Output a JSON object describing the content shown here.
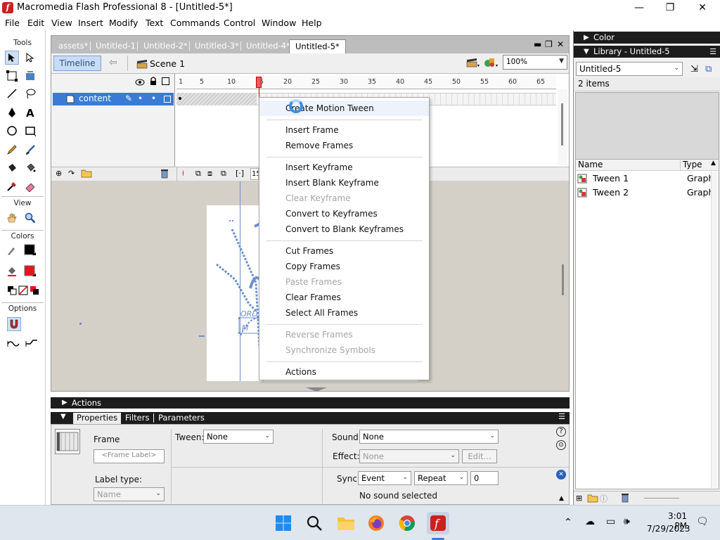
{
  "window": {
    "title": "Macromedia Flash Professional 8 - [Untitled-5*]",
    "minimize": "—",
    "maximize": "❐",
    "close": "✕"
  },
  "menu": [
    "File",
    "Edit",
    "View",
    "Insert",
    "Modify",
    "Text",
    "Commands",
    "Control",
    "Window",
    "Help"
  ],
  "toolbox": {
    "tools_label": "Tools",
    "view_label": "View",
    "colors_label": "Colors",
    "options_label": "Options",
    "stroke_color": "#000000",
    "fill_color": "#e8141b"
  },
  "document": {
    "tabs": [
      "assets*",
      "Untitled-1",
      "Untitled-2*",
      "Untitled-3*",
      "Untitled-4*",
      "Untitled-5*"
    ],
    "active_tab": "Untitled-5*",
    "timeline_button": "Timeline",
    "scene": "Scene 1",
    "zoom": "100%"
  },
  "timeline": {
    "layer_name": "content",
    "ruler": [
      "1",
      "5",
      "10",
      "15",
      "20",
      "25",
      "30",
      "35",
      "40",
      "45",
      "50",
      "55",
      "60",
      "65"
    ],
    "current_frame": "15",
    "frame_field": "15"
  },
  "stage": {
    "text_1": "ORD",
    "text_2": "M"
  },
  "context_menu": [
    {
      "label": "Create Motion Tween",
      "enabled": true,
      "hover": true
    },
    {
      "sep": true
    },
    {
      "label": "Insert Frame",
      "enabled": true
    },
    {
      "label": "Remove Frames",
      "enabled": true
    },
    {
      "sep": true
    },
    {
      "label": "Insert Keyframe",
      "enabled": true
    },
    {
      "label": "Insert Blank Keyframe",
      "enabled": true
    },
    {
      "label": "Clear Keyframe",
      "enabled": false
    },
    {
      "label": "Convert to Keyframes",
      "enabled": true
    },
    {
      "label": "Convert to Blank Keyframes",
      "enabled": true
    },
    {
      "sep": true
    },
    {
      "label": "Cut Frames",
      "enabled": true
    },
    {
      "label": "Copy Frames",
      "enabled": true
    },
    {
      "label": "Paste Frames",
      "enabled": false
    },
    {
      "label": "Clear Frames",
      "enabled": true
    },
    {
      "label": "Select All Frames",
      "enabled": true
    },
    {
      "sep": true
    },
    {
      "label": "Reverse Frames",
      "enabled": false
    },
    {
      "label": "Synchronize Symbols",
      "enabled": false
    },
    {
      "sep": true
    },
    {
      "label": "Actions",
      "enabled": true
    }
  ],
  "panels": {
    "color_title": "Color",
    "library_title": "Library - Untitled-5",
    "library_select": "Untitled-5",
    "library_count": "2 items",
    "columns": {
      "name": "Name",
      "type": "Type"
    },
    "items": [
      {
        "name": "Tween 1",
        "type": "Graph"
      },
      {
        "name": "Tween 2",
        "type": "Graph"
      }
    ]
  },
  "actions_panel": {
    "title": "Actions"
  },
  "properties": {
    "tabs": [
      "Properties",
      "Filters",
      "Parameters"
    ],
    "frame_label": "Frame",
    "frame_label_placeholder": "<Frame Label>",
    "label_type_label": "Label type:",
    "label_type_value": "Name",
    "tween_label": "Tween:",
    "tween_value": "None",
    "sound_label": "Sound:",
    "sound_value": "None",
    "effect_label": "Effect:",
    "effect_value": "None",
    "edit_button": "Edit...",
    "sync_label": "Sync:",
    "sync_value": "Event",
    "repeat_value": "Repeat",
    "repeat_count": "0",
    "sound_status": "No sound selected"
  },
  "taskbar": {
    "time": "3:01 PM",
    "date": "7/29/2023"
  }
}
